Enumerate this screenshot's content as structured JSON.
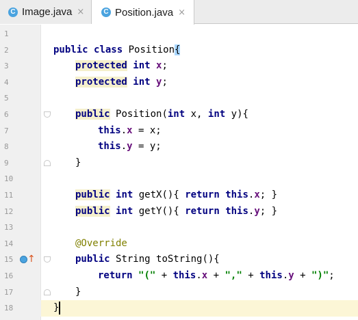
{
  "tabs": [
    {
      "label": "Image.java",
      "icon": "java-class-icon",
      "icon_letter": "C",
      "active": false
    },
    {
      "label": "Position.java",
      "icon": "java-class-icon",
      "icon_letter": "C",
      "active": true
    }
  ],
  "close_glyph": "×",
  "editor": {
    "current_line": 18,
    "lines": [
      {
        "n": "1"
      },
      {
        "n": "2"
      },
      {
        "n": "3"
      },
      {
        "n": "4"
      },
      {
        "n": "5"
      },
      {
        "n": "6"
      },
      {
        "n": "7"
      },
      {
        "n": "8"
      },
      {
        "n": "9"
      },
      {
        "n": "10"
      },
      {
        "n": "11"
      },
      {
        "n": "12"
      },
      {
        "n": "13"
      },
      {
        "n": "14"
      },
      {
        "n": "15"
      },
      {
        "n": "16"
      },
      {
        "n": "17"
      },
      {
        "n": "18"
      }
    ],
    "code": {
      "l2": [
        "public",
        "class",
        "Position",
        "{"
      ],
      "l3": [
        "protected",
        "int",
        "x",
        ";"
      ],
      "l4": [
        "protected",
        "int",
        "y",
        ";"
      ],
      "l6": [
        "public",
        "Position(",
        "int",
        "x, ",
        "int",
        "y){"
      ],
      "l7": [
        "this",
        ".",
        "x",
        " = x;"
      ],
      "l8": [
        "this",
        ".",
        "y",
        " = y;"
      ],
      "l9": [
        "}"
      ],
      "l11": [
        "public",
        "int",
        "getX(){ ",
        "return",
        "this",
        ".",
        "x",
        "; }"
      ],
      "l12": [
        "public",
        "int",
        "getY(){ ",
        "return",
        "this",
        ".",
        "y",
        "; }"
      ],
      "l14": [
        "@Override"
      ],
      "l15": [
        "public",
        "String toString(){"
      ],
      "l16": [
        "return",
        "\"(\"",
        " + ",
        "this",
        ".",
        "x",
        " + ",
        "\",\"",
        " + ",
        "this",
        ".",
        "y",
        " + ",
        "\")\"",
        ";"
      ],
      "l17": [
        "}"
      ],
      "l18": [
        "}"
      ]
    }
  },
  "colors": {
    "keyword": "#000080",
    "field": "#660e7a",
    "string": "#008000",
    "annotation": "#808000",
    "caret_line": "#fcf6d6"
  }
}
